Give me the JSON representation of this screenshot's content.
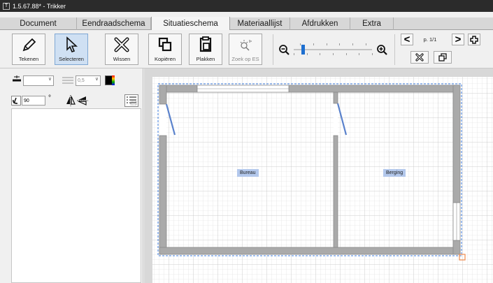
{
  "window": {
    "title": "1.5.67.88* - Trikker"
  },
  "tabs": [
    {
      "label": "Document",
      "active": false
    },
    {
      "label": "Eendraadschema",
      "active": false
    },
    {
      "label": "Situatieschema",
      "active": true
    },
    {
      "label": "Materiaallijst",
      "active": false
    },
    {
      "label": "Afdrukken",
      "active": false
    },
    {
      "label": "Extra",
      "active": false
    }
  ],
  "toolbar": {
    "tekenen": "Tekenen",
    "selecteren": "Selecteren",
    "wissen": "Wissen",
    "kopieren": "Kopiëren",
    "plakken": "Plakken",
    "zoek_op_es": "Zoek op ES",
    "page_indicator": "p. 1/1",
    "prev": "<",
    "next": ">",
    "zoom_level_fraction": 0.1
  },
  "properties": {
    "line_width": "0,5",
    "rotation": "90",
    "degree_symbol": "°",
    "color": "#000000"
  },
  "rooms": [
    {
      "label": "Bureau"
    },
    {
      "label": "Berging"
    }
  ],
  "icons": {
    "tekenen": "pencil-icon",
    "selecteren": "cursor-icon",
    "wissen": "erase-icon",
    "kopieren": "copy-icon",
    "plakken": "paste-icon",
    "zoek_op_es": "search-es-icon",
    "zoom_out": "zoom-out-icon",
    "zoom_in": "zoom-in-icon",
    "add_page": "add-page-icon",
    "delete_page": "delete-page-icon",
    "duplicate_page": "duplicate-page-icon"
  }
}
